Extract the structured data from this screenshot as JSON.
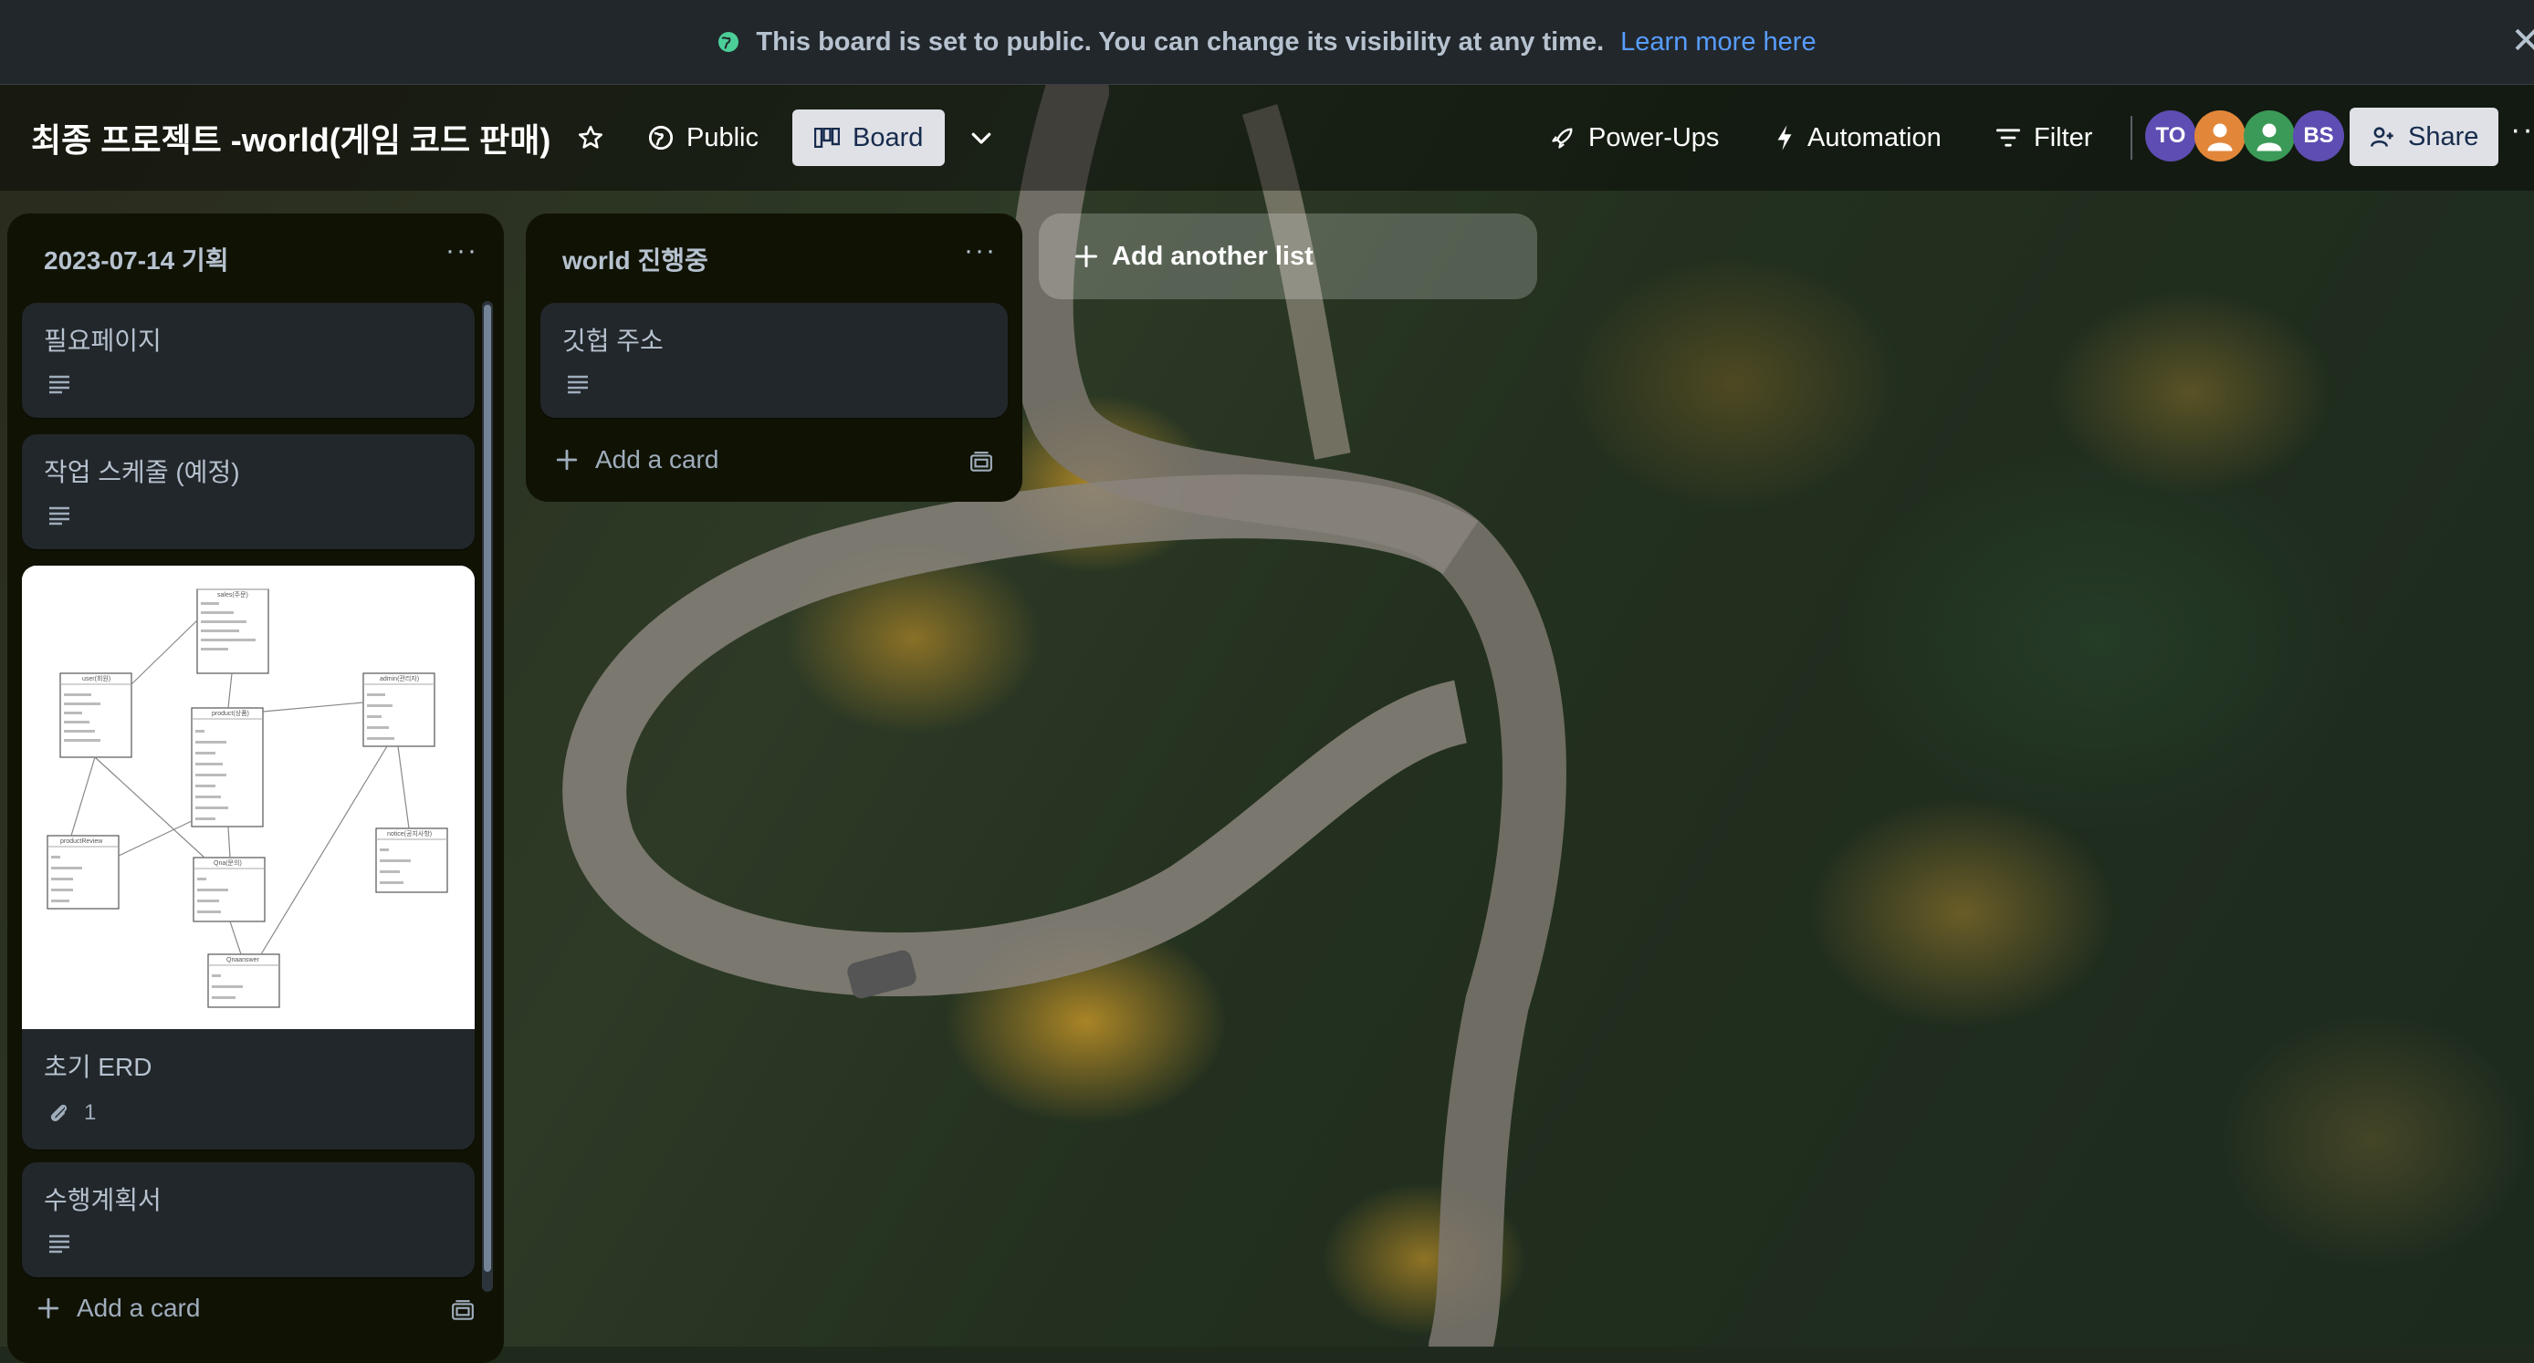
{
  "banner": {
    "message": "This board is set to public. You can change its visibility at any time.",
    "link": "Learn more here",
    "close": "✕"
  },
  "header": {
    "board_title": "최종 프로젝트 -world(게임 코드 판매)",
    "visibility_label": "Public",
    "view_label": "Board",
    "powerups_label": "Power-Ups",
    "automation_label": "Automation",
    "filter_label": "Filter",
    "share_label": "Share",
    "avatars": [
      {
        "initials": "TO",
        "color": "#5e4db2"
      },
      {
        "initials": "",
        "color": "#e2873a"
      },
      {
        "initials": "",
        "color": "#3b9a57"
      },
      {
        "initials": "BS",
        "color": "#5e4db2"
      }
    ]
  },
  "lists": [
    {
      "title": "2023-07-14 기획",
      "menu": "···",
      "cards": [
        {
          "title": "필요페이지",
          "has_description": true
        },
        {
          "title": "작업 스케줄 (예정)",
          "has_description": true
        },
        {
          "title": "초기 ERD",
          "attachments": "1",
          "has_cover_image": true
        },
        {
          "title": "수행계획서",
          "has_description": true
        }
      ],
      "add_card_label": "Add a card"
    },
    {
      "title": "world 진행중",
      "menu": "···",
      "cards": [
        {
          "title": "깃헙 주소",
          "has_description": true
        }
      ],
      "add_card_label": "Add a card"
    }
  ],
  "add_list_label": "Add another list",
  "erd": {
    "entities": [
      "sales(주문)",
      "user(회원)",
      "product(상품)",
      "admin(관리자)",
      "productReview",
      "Qna(문의)",
      "notice(공지사항)",
      "Qnaanswer"
    ]
  }
}
